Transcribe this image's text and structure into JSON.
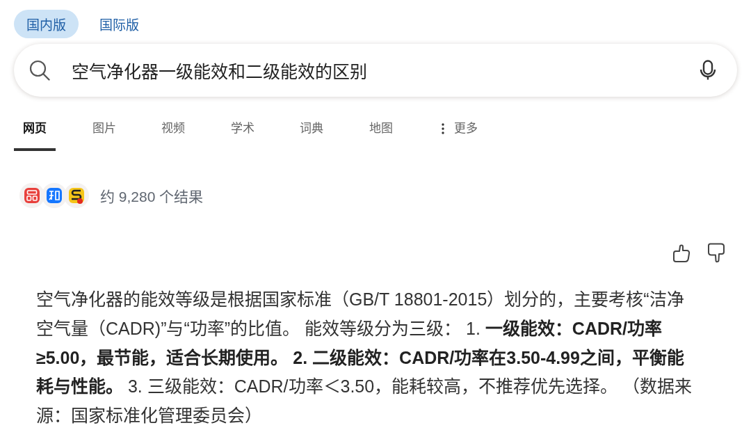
{
  "version_tabs": [
    {
      "label": "国内版",
      "selected": true
    },
    {
      "label": "国际版",
      "selected": false
    }
  ],
  "search": {
    "value": "空气净化器一级能效和二级能效的区别"
  },
  "nav_tabs": [
    {
      "label": "网页",
      "selected": true,
      "kind": "tab"
    },
    {
      "label": "图片",
      "selected": false,
      "kind": "tab"
    },
    {
      "label": "视频",
      "selected": false,
      "kind": "tab"
    },
    {
      "label": "学术",
      "selected": false,
      "kind": "tab"
    },
    {
      "label": "词典",
      "selected": false,
      "kind": "tab"
    },
    {
      "label": "地图",
      "selected": false,
      "kind": "tab"
    },
    {
      "label": "更多",
      "selected": false,
      "kind": "menu"
    }
  ],
  "results": {
    "count": "约 9,280 个结果"
  },
  "answer": {
    "text": "空气净化器的能效等级是根据国家标准（GB/T 18801-2015）划分的，主要考核“洁净空气量（CADR)”与“功率”的比值。 能效等级分为三级： 1. **一级能效：CADR/功率≥5.00，最节能，适合长期使用。 2. 二级能效：CADR/功率在3.50-4.99之间，平衡能耗与性能。** 3. 三级能效：CADR/功率＜3.50，能耗较高，不推荐优先选择。 （数据来源：国家标准化管理委员会）"
  }
}
